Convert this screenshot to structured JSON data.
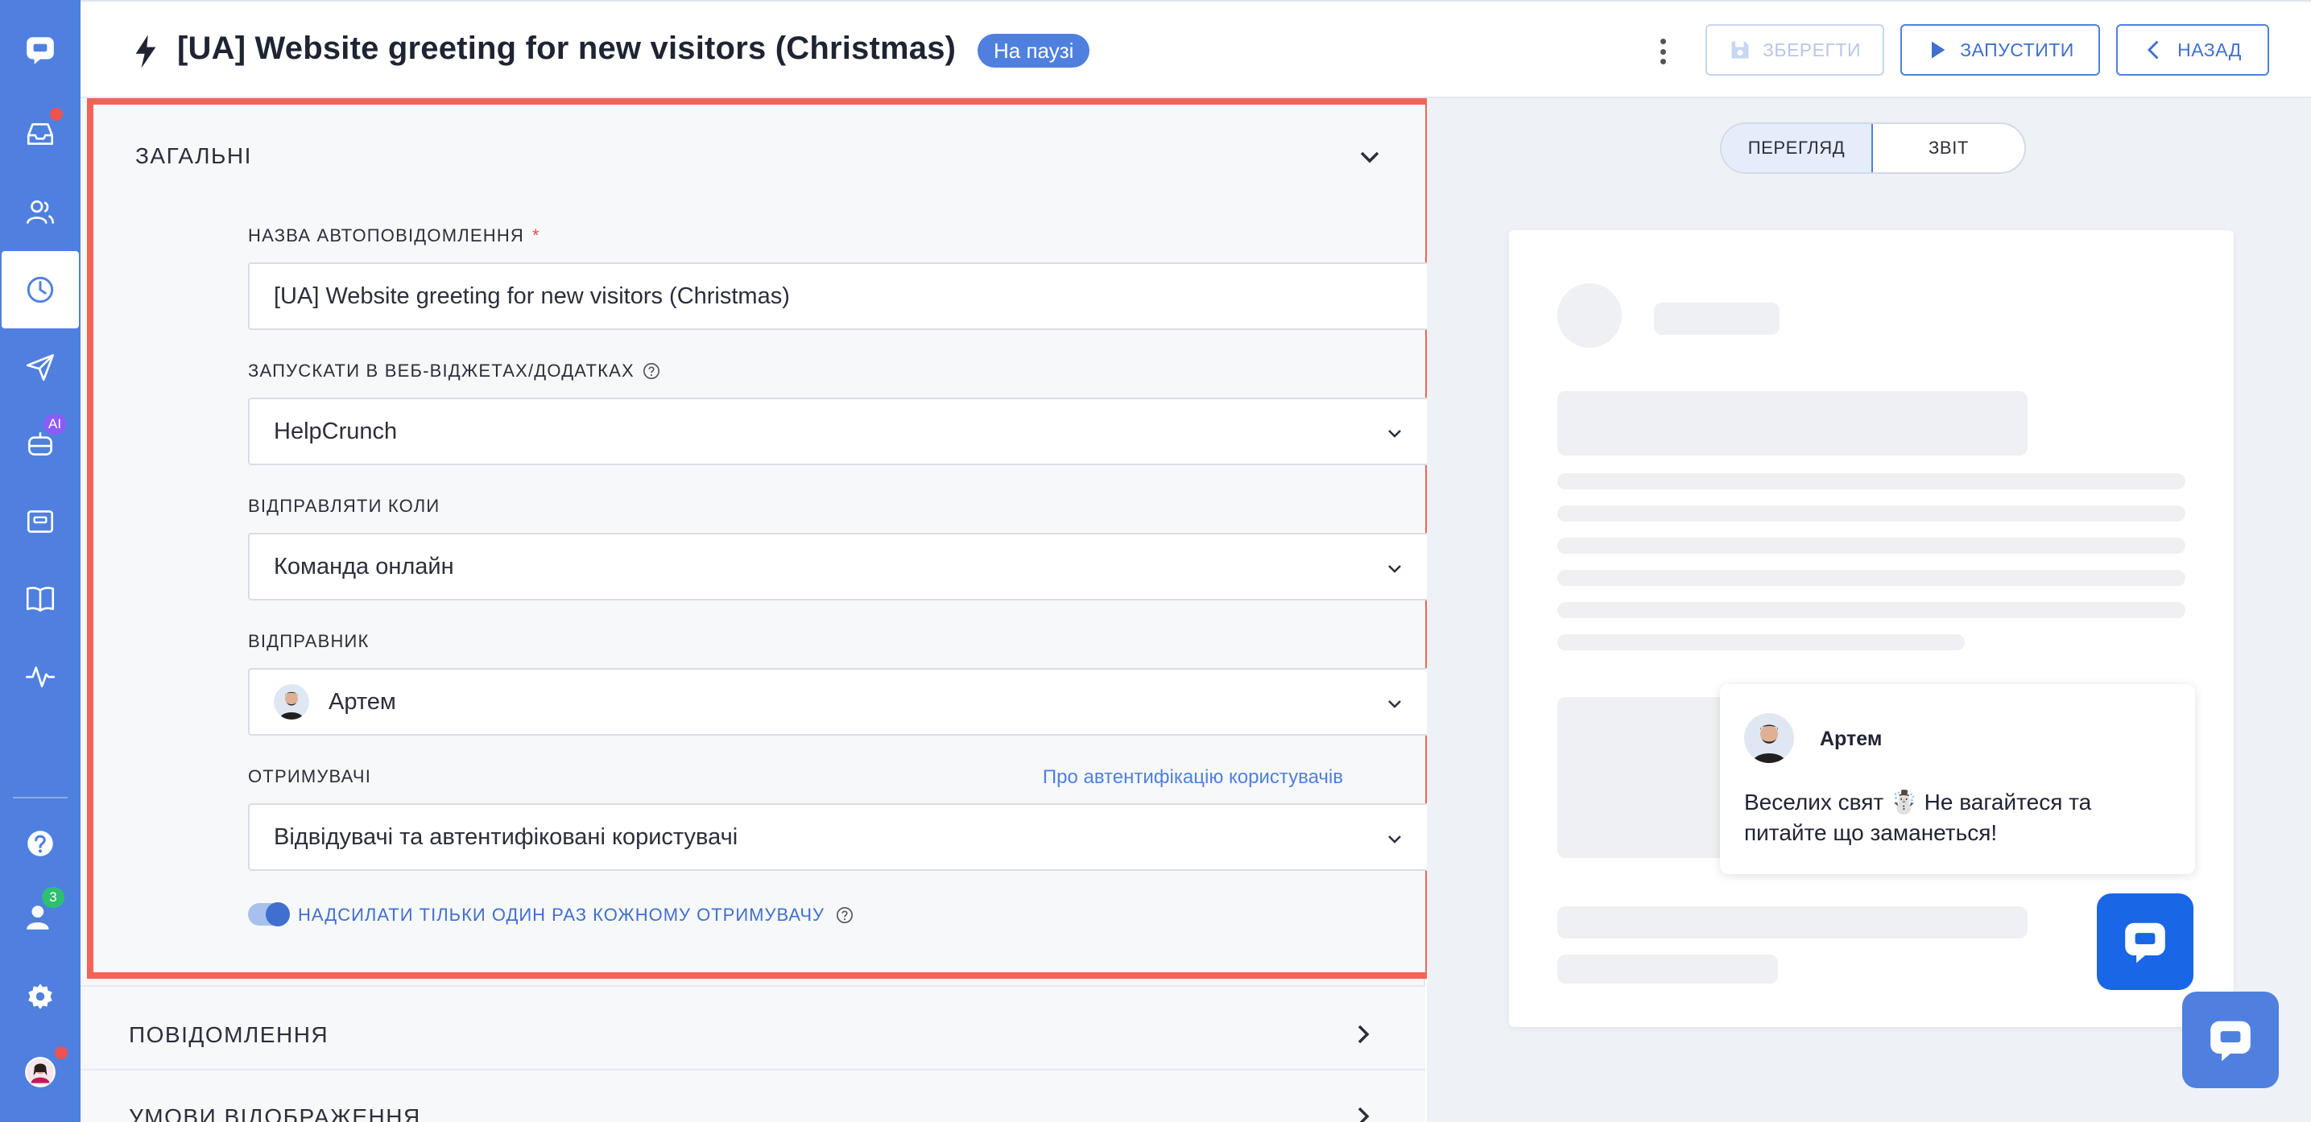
{
  "header": {
    "title": "[UA] Website greeting for new visitors (Christmas)",
    "status": "На паузі",
    "save_label": "ЗБЕРЕГТИ",
    "run_label": "ЗАПУСТИТИ",
    "back_label": "НАЗАД"
  },
  "sidebar": {
    "badges": {
      "ai": "AI",
      "contacts": "3"
    }
  },
  "general": {
    "title": "ЗАГАЛЬНІ",
    "name_label": "НАЗВА АВТОПОВІДОМЛЕННЯ",
    "name_required": "*",
    "name_value": "[UA] Website greeting for new visitors (Christmas)",
    "widgets_label": "ЗАПУСКАТИ В ВЕБ-ВІДЖЕТАХ/ДОДАТКАХ",
    "widgets_value": "HelpCrunch",
    "send_when_label": "ВІДПРАВЛЯТИ КОЛИ",
    "send_when_value": "Команда онлайн",
    "sender_label": "ВІДПРАВНИК",
    "sender_value": "Артем",
    "recipients_label": "ОТРИМУВАЧІ",
    "recipients_link": "Про автентифікацію користувачів",
    "recipients_value": "Відвідувачі та автентифіковані користувачі",
    "once_toggle_label": "НАДСИЛАТИ ТІЛЬКИ ОДИН РАЗ КОЖНОМУ ОТРИМУВАЧУ",
    "once_toggle_on": true
  },
  "sections": {
    "messages": "ПОВІДОМЛЕННЯ",
    "display_conditions": "УМОВИ ВІДОБРАЖЕННЯ"
  },
  "preview": {
    "tab_preview": "ПЕРЕГЛЯД",
    "tab_report": "ЗВІТ",
    "sender_name": "Артем",
    "message": "Веселих свят ☃️ Не вагайтеся та питайте що заманеться!"
  },
  "colors": {
    "accent": "#4f80df",
    "highlight_border": "#f26455"
  }
}
